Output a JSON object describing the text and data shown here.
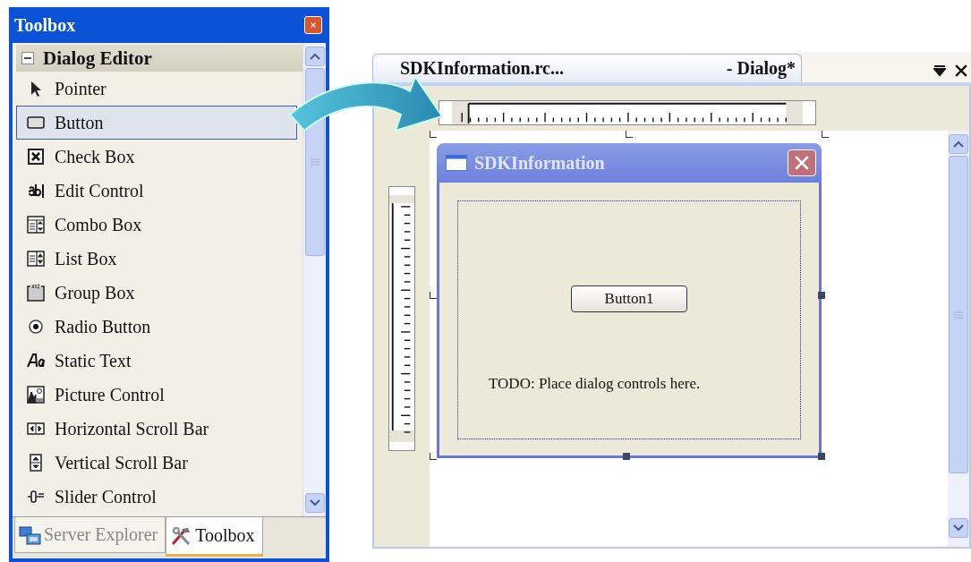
{
  "toolbox": {
    "title": "Toolbox",
    "section": {
      "label": "Dialog Editor",
      "expanded": true
    },
    "items": [
      {
        "label": "Pointer",
        "kind": "pointer",
        "selected": false
      },
      {
        "label": "Button",
        "kind": "button",
        "selected": true
      },
      {
        "label": "Check Box",
        "kind": "checkbox",
        "selected": false
      },
      {
        "label": "Edit Control",
        "kind": "edit",
        "selected": false
      },
      {
        "label": "Combo Box",
        "kind": "combo",
        "selected": false
      },
      {
        "label": "List Box",
        "kind": "list",
        "selected": false
      },
      {
        "label": "Group Box",
        "kind": "group",
        "selected": false
      },
      {
        "label": "Radio Button",
        "kind": "radio",
        "selected": false
      },
      {
        "label": "Static Text",
        "kind": "static",
        "selected": false
      },
      {
        "label": "Picture Control",
        "kind": "picture",
        "selected": false
      },
      {
        "label": "Horizontal Scroll Bar",
        "kind": "hscroll",
        "selected": false
      },
      {
        "label": "Vertical Scroll Bar",
        "kind": "vscroll",
        "selected": false
      },
      {
        "label": "Slider Control",
        "kind": "slider",
        "selected": false
      }
    ],
    "tabs": [
      {
        "label": "Server Explorer",
        "kind": "server",
        "selected": false
      },
      {
        "label": "Toolbox",
        "kind": "tools",
        "selected": true
      }
    ]
  },
  "editor": {
    "tab": {
      "file": "SDKInformation.rc...",
      "title": "- Dialog*"
    },
    "dialog": {
      "title": "SDKInformation",
      "button": "Button1",
      "text": "TODO: Place dialog controls here."
    }
  }
}
